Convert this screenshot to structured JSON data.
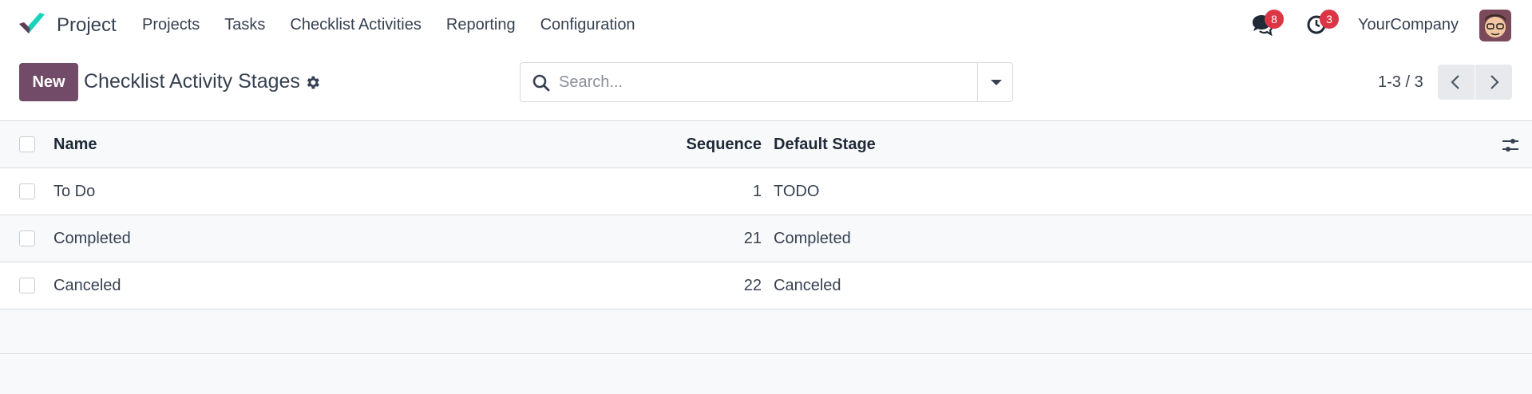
{
  "app": {
    "name": "Project"
  },
  "menu": [
    "Projects",
    "Tasks",
    "Checklist Activities",
    "Reporting",
    "Configuration"
  ],
  "systray": {
    "messages_badge": "8",
    "activities_badge": "3",
    "company": "YourCompany"
  },
  "control": {
    "new_label": "New",
    "title": "Checklist Activity Stages",
    "search_placeholder": "Search...",
    "pager": "1-3 / 3"
  },
  "table": {
    "headers": {
      "name": "Name",
      "sequence": "Sequence",
      "default_stage": "Default Stage"
    },
    "rows": [
      {
        "name": "To Do",
        "sequence": "1",
        "default_stage": "TODO"
      },
      {
        "name": "Completed",
        "sequence": "21",
        "default_stage": "Completed"
      },
      {
        "name": "Canceled",
        "sequence": "22",
        "default_stage": "Canceled"
      }
    ]
  },
  "colors": {
    "brand": "#714b67",
    "badge": "#dc3545",
    "logo_teal": "#1ad3bb",
    "logo_purple": "#714b67"
  },
  "icons": [
    "app-logo-icon",
    "chat-icon",
    "clock-icon",
    "gear-icon",
    "search-icon",
    "chevron-down-icon",
    "chevron-left-icon",
    "chevron-right-icon",
    "sliders-icon"
  ]
}
